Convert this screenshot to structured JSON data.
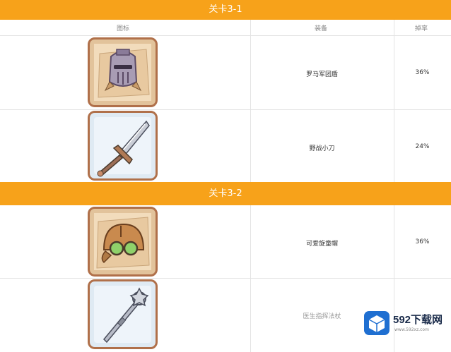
{
  "sections": [
    {
      "title": "关卡3-1"
    },
    {
      "title": "关卡3-2"
    }
  ],
  "header": {
    "col_icon": "图标",
    "col_equip": "装备",
    "col_rate": "掉率"
  },
  "rows": [
    {
      "icon": "gladiator-helmet-icon",
      "name": "罗马军团盾",
      "rate": "36%"
    },
    {
      "icon": "broadsword-icon",
      "name": "野战小刀",
      "rate": "24%"
    },
    {
      "icon": "goggles-cap-icon",
      "name": "可爱旋童帽",
      "rate": "36%"
    },
    {
      "icon": "mace-staff-icon",
      "name": "医生指挥法杖",
      "rate": ""
    }
  ],
  "watermark": {
    "brand": "592下载网",
    "url": "www.592xz.com"
  },
  "colors": {
    "accent": "#f7a21a",
    "frame": "#b0704a",
    "brand_blue": "#1f6fd1"
  }
}
